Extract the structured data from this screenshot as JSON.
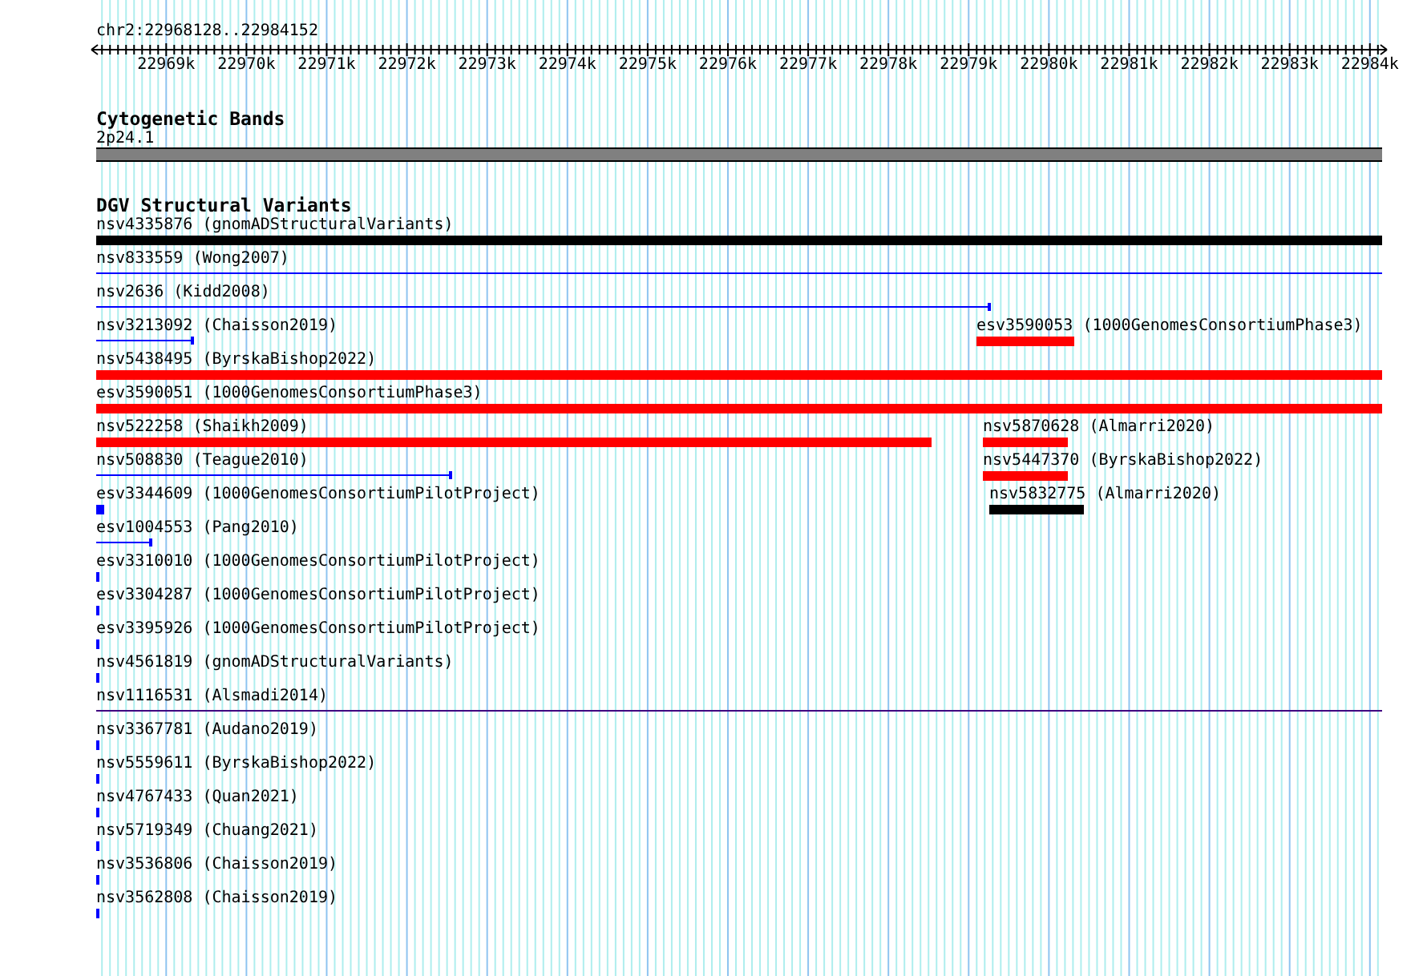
{
  "ruler": {
    "location": "chr2:22968128..22984152",
    "ticks": [
      {
        "label": "22969k"
      },
      {
        "label": "22970k"
      },
      {
        "label": "22971k"
      },
      {
        "label": "22972k"
      },
      {
        "label": "22973k"
      },
      {
        "label": "22974k"
      },
      {
        "label": "22975k"
      },
      {
        "label": "22976k"
      },
      {
        "label": "22977k"
      },
      {
        "label": "22978k"
      },
      {
        "label": "22979k"
      },
      {
        "label": "22980k"
      },
      {
        "label": "22981k"
      },
      {
        "label": "22982k"
      },
      {
        "label": "22983k"
      },
      {
        "label": "22984k"
      }
    ]
  },
  "tracks": [
    {
      "title": "Cytogenetic Bands",
      "lanes": [
        [
          {
            "label": "2p24.1",
            "kind": "band",
            "color": "#808080"
          }
        ]
      ]
    },
    {
      "title": "DGV Structural Variants",
      "lanes": [
        [
          {
            "label": "nsv4335876 (gnomADStructuralVariants)",
            "kind": "bar",
            "color": "#000000"
          }
        ],
        [
          {
            "label": "nsv833559 (Wong2007)",
            "kind": "line",
            "color": "#0000ff"
          }
        ],
        [
          {
            "label": "nsv2636 (Kidd2008)",
            "kind": "line",
            "color": "#0000ff"
          }
        ],
        [
          {
            "label": "nsv3213092 (Chaisson2019)",
            "kind": "line",
            "color": "#0000ff"
          },
          {
            "label": "esv3590053 (1000GenomesConsortiumPhase3)",
            "kind": "bar",
            "color": "#ff0000"
          }
        ],
        [
          {
            "label": "nsv5438495 (ByrskaBishop2022)",
            "kind": "bar",
            "color": "#ff0000"
          }
        ],
        [
          {
            "label": "esv3590051 (1000GenomesConsortiumPhase3)",
            "kind": "bar",
            "color": "#ff0000"
          }
        ],
        [
          {
            "label": "nsv522258 (Shaikh2009)",
            "kind": "bar",
            "color": "#ff0000"
          },
          {
            "label": "nsv5870628 (Almarri2020)",
            "kind": "bar",
            "color": "#ff0000"
          }
        ],
        [
          {
            "label": "nsv508830 (Teague2010)",
            "kind": "line",
            "color": "#0000ff"
          },
          {
            "label": "nsv5447370 (ByrskaBishop2022)",
            "kind": "bar",
            "color": "#ff0000"
          }
        ],
        [
          {
            "label": "esv3344609 (1000GenomesConsortiumPilotProject)",
            "kind": "bar",
            "color": "#0000ff"
          },
          {
            "label": "nsv5832775 (Almarri2020)",
            "kind": "bar",
            "color": "#000000"
          }
        ],
        [
          {
            "label": "esv1004553 (Pang2010)",
            "kind": "line",
            "color": "#0000ff"
          }
        ],
        [
          {
            "label": "esv3310010 (1000GenomesConsortiumPilotProject)",
            "kind": "bar",
            "color": "#0000ff"
          }
        ],
        [
          {
            "label": "esv3304287 (1000GenomesConsortiumPilotProject)",
            "kind": "bar",
            "color": "#0000ff"
          }
        ],
        [
          {
            "label": "esv3395926 (1000GenomesConsortiumPilotProject)",
            "kind": "bar",
            "color": "#0000ff"
          }
        ],
        [
          {
            "label": "nsv4561819 (gnomADStructuralVariants)",
            "kind": "bar",
            "color": "#0000ff"
          }
        ],
        [
          {
            "label": "nsv1116531 (Alsmadi2014)",
            "kind": "line",
            "color": "#400080"
          }
        ],
        [
          {
            "label": "nsv3367781 (Audano2019)",
            "kind": "bar",
            "color": "#0000ff"
          }
        ],
        [
          {
            "label": "nsv5559611 (ByrskaBishop2022)",
            "kind": "bar",
            "color": "#0000ff"
          }
        ],
        [
          {
            "label": "nsv4767433 (Quan2021)",
            "kind": "bar",
            "color": "#0000ff"
          }
        ],
        [
          {
            "label": "nsv5719349 (Chuang2021)",
            "kind": "bar",
            "color": "#0000ff"
          }
        ],
        [
          {
            "label": "nsv3536806 (Chaisson2019)",
            "kind": "bar",
            "color": "#0000ff"
          }
        ],
        [
          {
            "label": "nsv3562808 (Chaisson2019)",
            "kind": "bar",
            "color": "#0000ff"
          }
        ]
      ]
    }
  ]
}
